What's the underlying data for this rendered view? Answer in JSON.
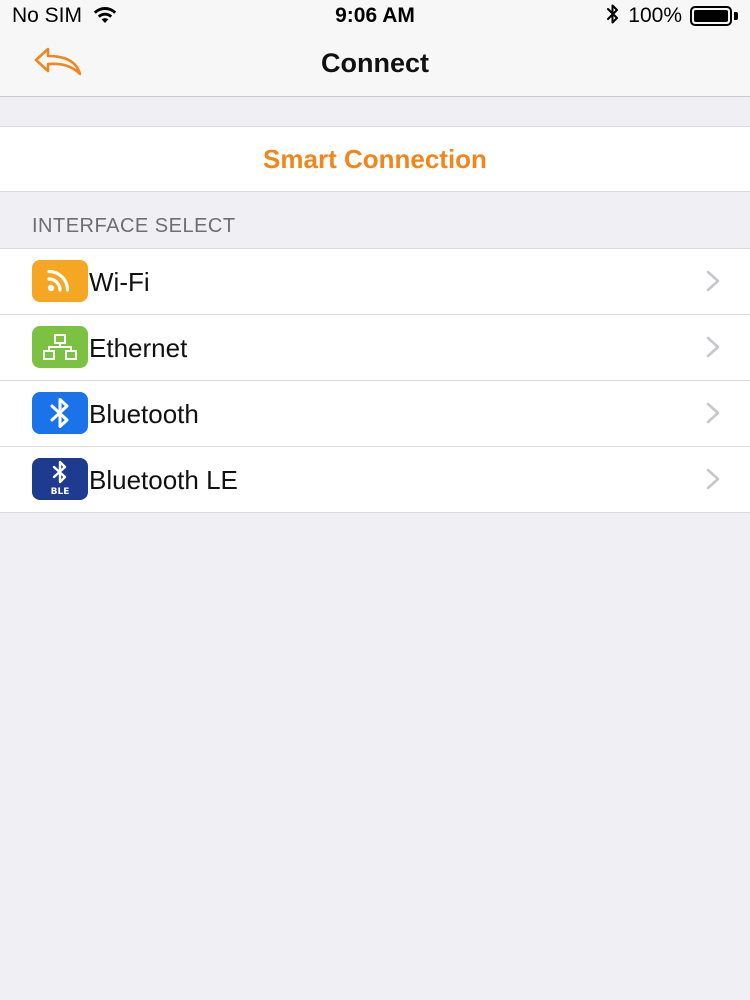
{
  "status_bar": {
    "carrier": "No SIM",
    "time": "9:06 AM",
    "battery_percent": "100%",
    "battery_level": 1.0,
    "icons": [
      "wifi-icon",
      "bluetooth-icon",
      "battery-icon"
    ]
  },
  "nav": {
    "title": "Connect",
    "back_icon": "back-arrow-icon"
  },
  "smart_connection": {
    "label": "Smart Connection"
  },
  "interface_select": {
    "header": "INTERFACE SELECT",
    "items": [
      {
        "label": "Wi-Fi",
        "icon": "wifi-icon",
        "icon_color": "#f5a623"
      },
      {
        "label": "Ethernet",
        "icon": "ethernet-icon",
        "icon_color": "#7cc242"
      },
      {
        "label": "Bluetooth",
        "icon": "bluetooth-icon",
        "icon_color": "#1a73e8"
      },
      {
        "label": "Bluetooth LE",
        "icon": "bluetooth-le-icon",
        "icon_color": "#1f3b8f",
        "icon_text": "BLE"
      }
    ]
  },
  "colors": {
    "accent": "#f0861d",
    "background": "#efeff4",
    "nav_background": "#f7f7f7"
  }
}
